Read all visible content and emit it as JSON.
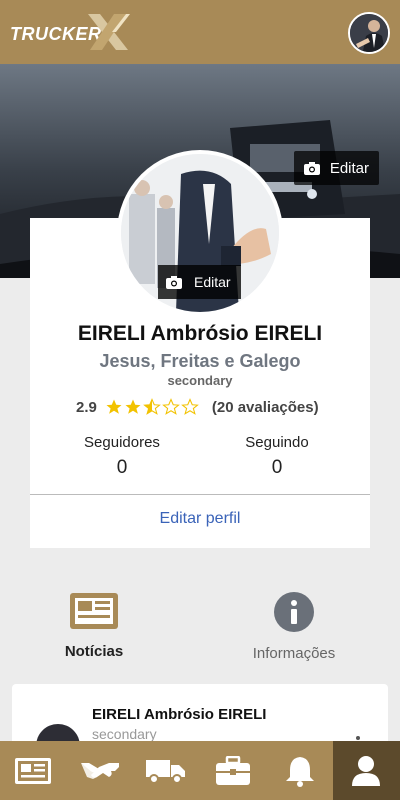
{
  "header": {
    "logo_text": "TRUCKER",
    "logo_mark": "X",
    "avatar_icon": "user-avatar"
  },
  "cover": {
    "edit_label": "Editar",
    "edit_icon": "camera-icon"
  },
  "profile": {
    "avatar_edit_label": "Editar",
    "name": "EIRELI Ambrósio EIRELI",
    "company": "Jesus, Freitas e Galego",
    "role": "secondary",
    "rating_value": "2.9",
    "rating_stars": 2.5,
    "rating_count": "(20 avaliações)",
    "followers_label": "Seguidores",
    "followers_value": "0",
    "following_label": "Seguindo",
    "following_value": "0",
    "edit_profile_label": "Editar perfil"
  },
  "tabs": [
    {
      "label": "Notícias",
      "icon": "newspaper-icon",
      "active": true
    },
    {
      "label": "Informações",
      "icon": "info-icon",
      "active": false
    }
  ],
  "post": {
    "author": "EIRELI Ambrósio EIRELI",
    "role": "secondary"
  },
  "bottom_nav": [
    {
      "icon": "newspaper-icon",
      "active": false
    },
    {
      "icon": "handshake-icon",
      "active": false
    },
    {
      "icon": "truck-icon",
      "active": false
    },
    {
      "icon": "briefcase-icon",
      "active": false
    },
    {
      "icon": "bell-icon",
      "active": false
    },
    {
      "icon": "user-icon",
      "active": true
    }
  ],
  "colors": {
    "brand": "#a88a57",
    "brand_dark": "#5c4a2c",
    "link": "#3a63b8",
    "star": "#f2c200"
  }
}
